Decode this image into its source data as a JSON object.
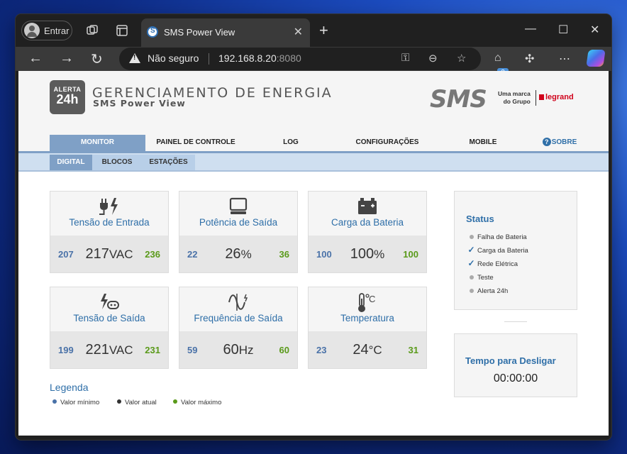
{
  "browser": {
    "profile_label": "Entrar",
    "tab_title": "SMS Power View",
    "security_label": "Não seguro",
    "url_host": "192.168.8.20",
    "url_port": ":8080",
    "extension_badge": "2"
  },
  "header": {
    "logo_top": "ALERTA",
    "logo_bottom": "24h",
    "title": "GERENCIAMENTO DE ENERGIA",
    "subtitle": "SMS Power View",
    "brand": "SMS",
    "brand_note_line1": "Uma marca",
    "brand_note_line2": "do Grupo",
    "legrand": "legrand"
  },
  "menu": [
    {
      "label": "MONITOR",
      "active": true
    },
    {
      "label": "PAINEL DE CONTROLE"
    },
    {
      "label": "LOG"
    },
    {
      "label": "CONFIGURAÇÕES"
    },
    {
      "label": "MOBILE"
    },
    {
      "label": "SOBRE",
      "icon": "help-icon"
    }
  ],
  "submenu": [
    {
      "label": "DIGITAL",
      "active": true
    },
    {
      "label": "BLOCOS"
    },
    {
      "label": "ESTAÇÕES"
    }
  ],
  "cards": [
    {
      "label": "Tensão de Entrada",
      "icon": "plug-icon",
      "min": "207",
      "value": "217",
      "unit": "VAC",
      "max": "236"
    },
    {
      "label": "Potência de Saída",
      "icon": "monitor-icon",
      "min": "22",
      "value": "26",
      "unit": "%",
      "max": "36"
    },
    {
      "label": "Carga da Bateria",
      "icon": "battery-icon",
      "min": "100",
      "value": "100",
      "unit": "%",
      "max": "100"
    },
    {
      "label": "Tensão de Saída",
      "icon": "outlet-icon",
      "min": "199",
      "value": "221",
      "unit": "VAC",
      "max": "231"
    },
    {
      "label": "Frequência de Saída",
      "icon": "sine-wave-icon",
      "min": "59",
      "value": "60",
      "unit": "Hz",
      "max": "60"
    },
    {
      "label": "Temperatura",
      "icon": "thermometer-icon",
      "min": "23",
      "value": "24",
      "unit": "°C",
      "max": "31"
    }
  ],
  "legend": {
    "title": "Legenda",
    "items": [
      {
        "label": "Valor mínimo",
        "color": "#4a72a8"
      },
      {
        "label": "Valor atual",
        "color": "#333333"
      },
      {
        "label": "Valor máximo",
        "color": "#5a9a1a"
      }
    ]
  },
  "status": {
    "title": "Status",
    "items": [
      {
        "label": "Falha de Bateria",
        "state": "off"
      },
      {
        "label": "Carga da Bateria",
        "state": "on"
      },
      {
        "label": "Rede Elétrica",
        "state": "on"
      },
      {
        "label": "Teste",
        "state": "off"
      },
      {
        "label": "Alerta 24h",
        "state": "off"
      }
    ]
  },
  "shutdown": {
    "title": "Tempo para Desligar",
    "value": "00:00:00"
  },
  "colors": {
    "accent": "#2f6fa8",
    "menu_active": "#7fa0c6",
    "submenu_bg": "#cfdff0",
    "min_value": "#4a72a8",
    "max_value": "#5a9a1a"
  }
}
